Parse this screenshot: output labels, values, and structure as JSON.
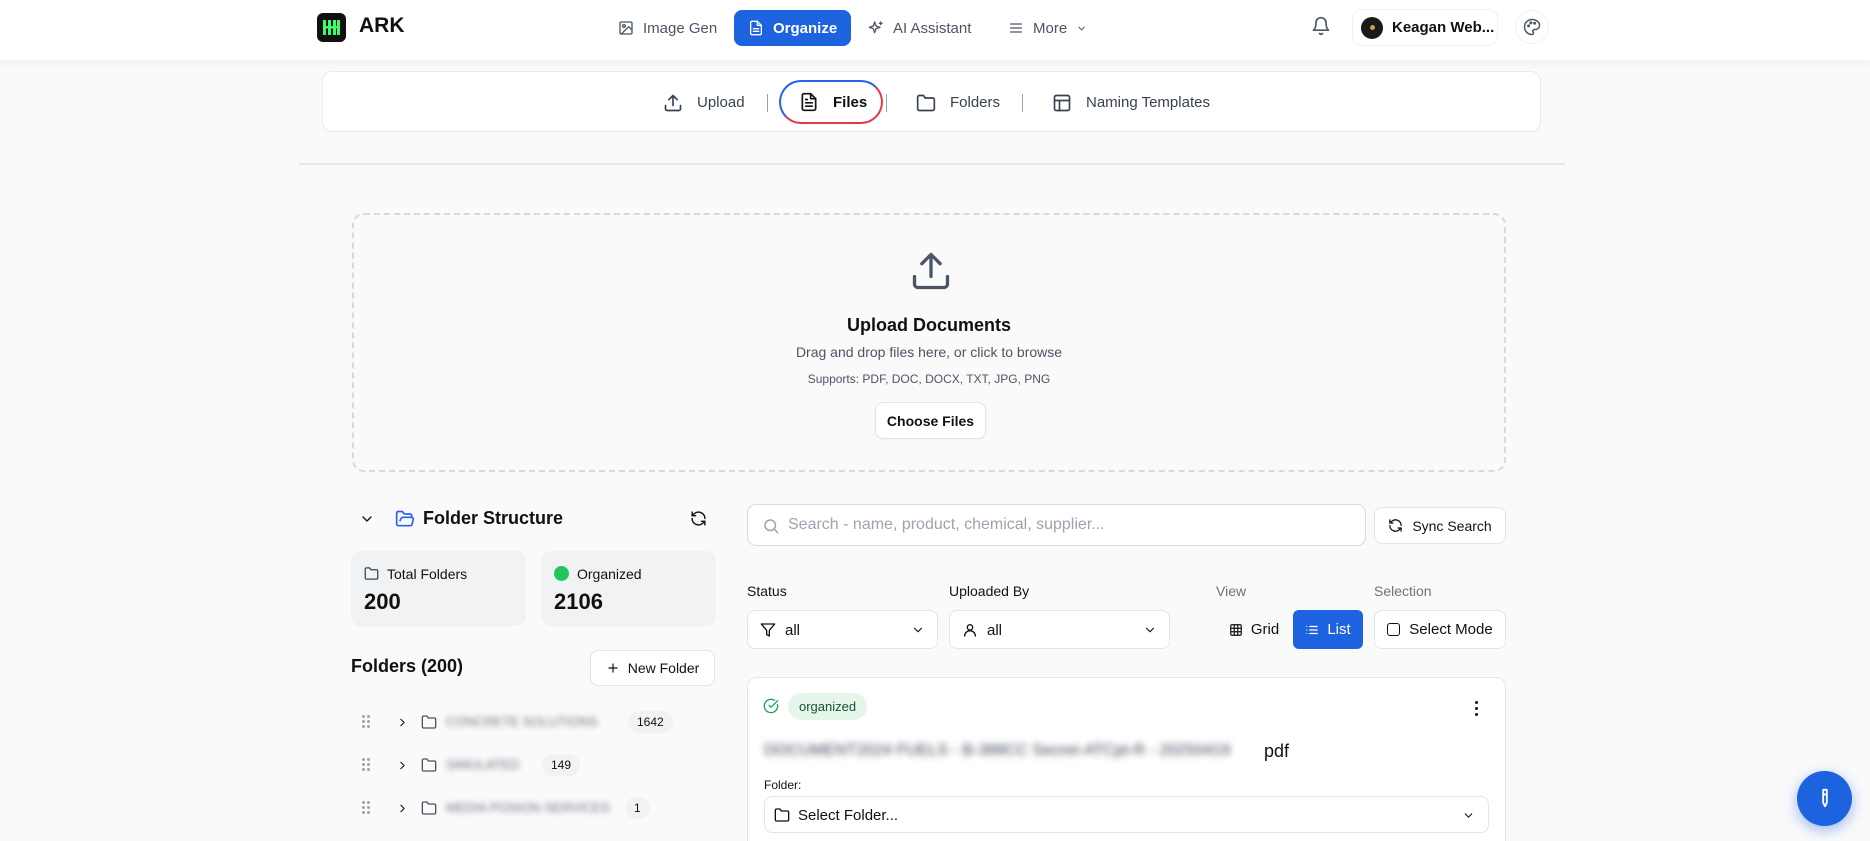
{
  "app": {
    "name": "ARK"
  },
  "nav": {
    "items": [
      {
        "label": "Image Gen",
        "icon": "image-icon"
      },
      {
        "label": "Organize",
        "icon": "document-icon",
        "active": true
      },
      {
        "label": "AI Assistant",
        "icon": "sparkle-icon"
      },
      {
        "label": "More",
        "icon": "menu-icon"
      }
    ],
    "user_name": "Keagan Web..."
  },
  "subtabs": [
    {
      "label": "Upload",
      "icon": "upload-icon"
    },
    {
      "label": "Files",
      "icon": "file-icon",
      "active": true
    },
    {
      "label": "Folders",
      "icon": "folder-icon"
    },
    {
      "label": "Naming Templates",
      "icon": "template-icon"
    }
  ],
  "upload": {
    "title": "Upload Documents",
    "subtitle": "Drag and drop files here, or click to browse",
    "supports": "Supports: PDF, DOC, DOCX, TXT, JPG, PNG",
    "button": "Choose Files"
  },
  "folder_structure": {
    "title": "Folder Structure",
    "stats": [
      {
        "label": "Total Folders",
        "value": "200"
      },
      {
        "label": "Organized",
        "value": "2106"
      }
    ],
    "folders_title": "Folders (200)",
    "new_folder": "New Folder",
    "folders": [
      {
        "name": "CONCRETE SOLUTIONS",
        "count": "1642"
      },
      {
        "name": "SIMULATED",
        "count": "149"
      },
      {
        "name": "MEDIA POSION SERVICES",
        "count": "1"
      }
    ]
  },
  "search": {
    "placeholder": "Search - name, product, chemical, supplier...",
    "sync_label": "Sync Search"
  },
  "filters": {
    "status_label": "Status",
    "status_value": "all",
    "uploaded_by_label": "Uploaded By",
    "uploaded_by_value": "all",
    "view_label": "View",
    "view_grid": "Grid",
    "view_list": "List",
    "selection_label": "Selection",
    "select_mode": "Select Mode"
  },
  "file_card": {
    "status": "organized",
    "filename_hidden": "DOCUMENT2024 FUELS - B-388CC Secret-ATCpt-R - 20250419",
    "extension": "pdf",
    "folder_label": "Folder:",
    "folder_select": "Select Folder..."
  },
  "colors": {
    "accent": "#1d63e0",
    "success": "#22c55e"
  }
}
